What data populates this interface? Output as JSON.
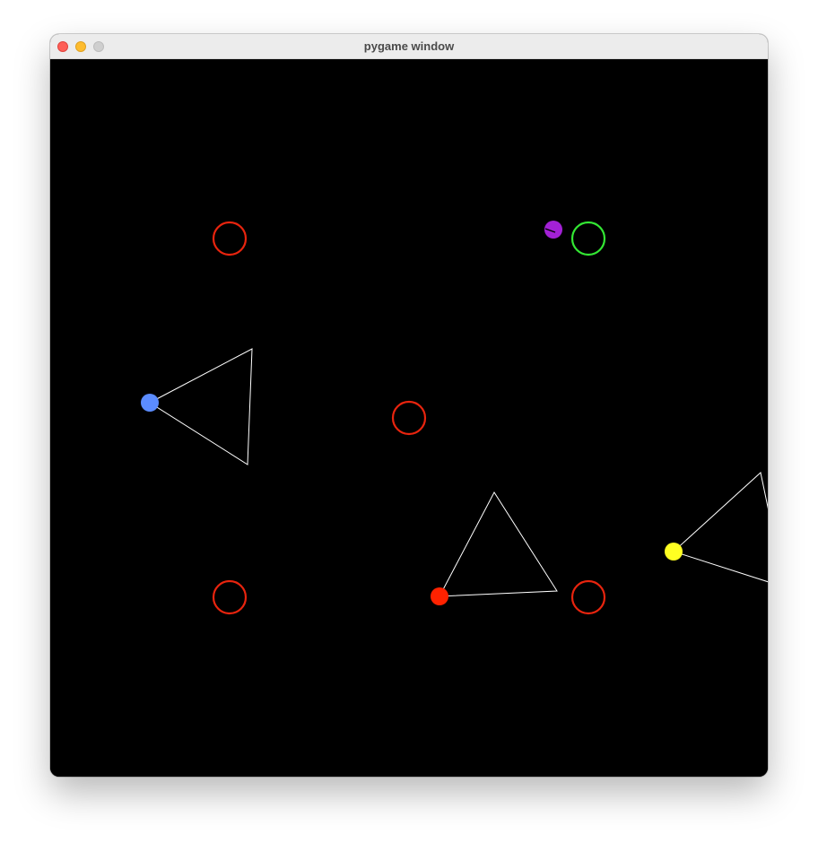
{
  "window": {
    "title": "pygame window"
  },
  "colors": {
    "background": "#000000",
    "target_ring_red": "#e8240e",
    "target_ring_green": "#33e633",
    "vision_cone": "#ffffff",
    "agent_blue": "#5b8cff",
    "agent_red": "#ff2200",
    "agent_yellow": "#ffff22",
    "agent_purple": "#a321d6"
  },
  "scene": {
    "targets": [
      {
        "name": "target-ring-top-left",
        "color": "red"
      },
      {
        "name": "target-ring-top-right",
        "color": "green"
      },
      {
        "name": "target-ring-center",
        "color": "red"
      },
      {
        "name": "target-ring-bottom-left",
        "color": "red"
      },
      {
        "name": "target-ring-bottom-right",
        "color": "red"
      }
    ],
    "agents": [
      {
        "name": "agent-blue",
        "color": "blue"
      },
      {
        "name": "agent-red",
        "color": "red"
      },
      {
        "name": "agent-yellow",
        "color": "yellow"
      },
      {
        "name": "agent-purple",
        "color": "purple"
      }
    ]
  }
}
